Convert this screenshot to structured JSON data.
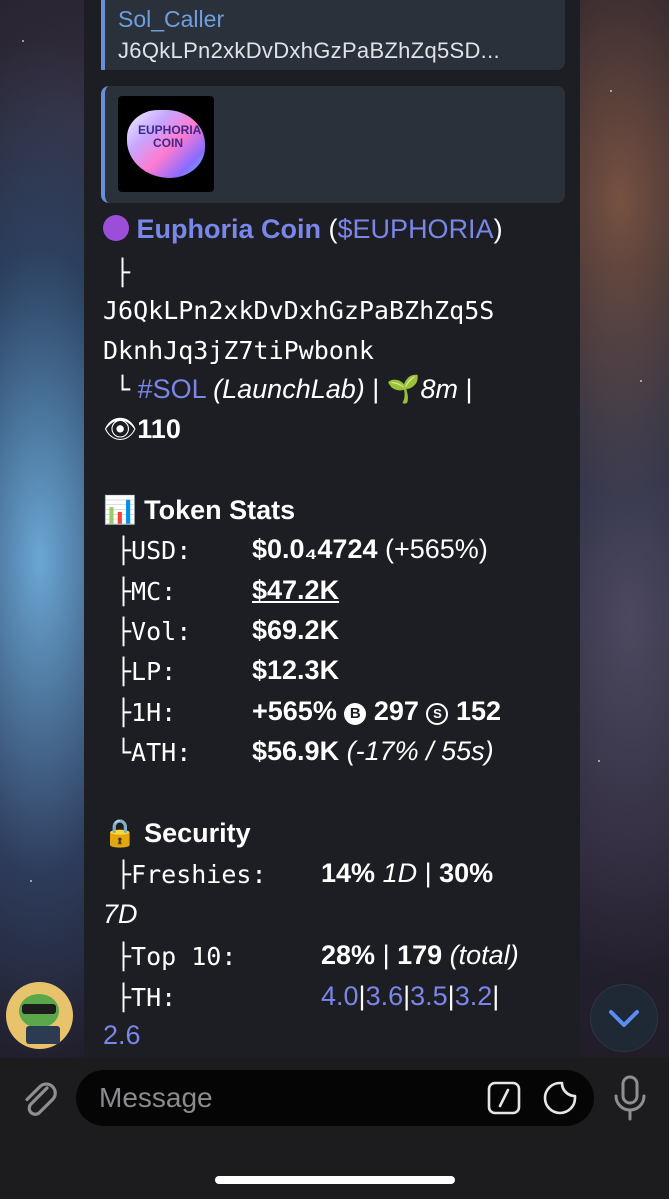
{
  "forward": {
    "sender": "Sol_Caller",
    "preview": "J6QkLPn2xkDvDxhGzPaBZhZq5SD..."
  },
  "media": {
    "thumbnail_text": "EUPHORIA COIN"
  },
  "token": {
    "name": "Euphoria Coin",
    "ticker": "$EUPHORIA",
    "open_paren": "(",
    "close_paren": ")",
    "branch_top": "├",
    "address_line1": "J6QkLPn2xkDvDxhGzPaBZhZq5S",
    "address_line2": "DknhJq3jZ7tiPwbonk",
    "branch_end": "└",
    "chain": "#SOL",
    "launchpad": "(LaunchLab)",
    "separator": "|",
    "age": "8m",
    "views": "110"
  },
  "stats": {
    "heading": "Token Stats",
    "rows": [
      {
        "prefix": "├USD:",
        "value": "$0.0₄4724",
        "extra": "(+565%)"
      },
      {
        "prefix": "├MC:",
        "value": "$47.2K"
      },
      {
        "prefix": "├Vol:",
        "value": "$69.2K"
      },
      {
        "prefix": "├LP:",
        "value": "$12.3K"
      },
      {
        "prefix": "├1H:",
        "value": "+565%",
        "buys_icon": "B",
        "buys": "297",
        "sells_icon": "S",
        "sells": "152"
      },
      {
        "prefix": "└ATH:",
        "value": "$56.9K",
        "extra": "(-17% / 55s)"
      }
    ]
  },
  "security": {
    "heading": "Security",
    "freshies_label": "├Freshies:",
    "freshies_1d": "14%",
    "freshies_1d_unit": "1D",
    "freshies_sep": "|",
    "freshies_7d": "30%",
    "freshies_7d_unit": "7D",
    "top10_label": "├Top 10:",
    "top10_pct": "28%",
    "top10_sep": "|",
    "top10_total": "179",
    "top10_total_label": "(total)",
    "th_label": "├TH:",
    "th_values": [
      "4.0",
      "3.6",
      "3.5",
      "3.2"
    ],
    "th_sep": "|",
    "th_last": "2.6"
  },
  "composer": {
    "placeholder": "Message"
  },
  "colors": {
    "link": "#7a86e8",
    "quote_accent": "#6b8fd6",
    "bubble": "#1c1e24"
  },
  "icons": {
    "bullet": "purple-circle-icon",
    "sprout": "seedling-icon",
    "eye": "eye-icon",
    "chart": "bar-chart-icon",
    "lock": "lock-icon",
    "attach": "paperclip-icon",
    "command": "slash-command-icon",
    "sticker": "sticker-icon",
    "mic": "microphone-icon",
    "scroll": "chevron-down-icon"
  }
}
